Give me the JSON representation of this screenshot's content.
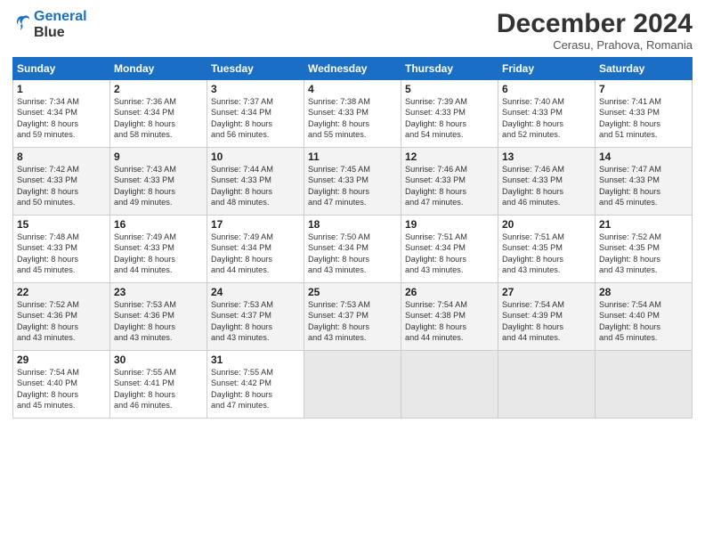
{
  "header": {
    "logo_line1": "General",
    "logo_line2": "Blue",
    "month_title": "December 2024",
    "subtitle": "Cerasu, Prahova, Romania"
  },
  "weekdays": [
    "Sunday",
    "Monday",
    "Tuesday",
    "Wednesday",
    "Thursday",
    "Friday",
    "Saturday"
  ],
  "weeks": [
    [
      {
        "day": "1",
        "sunrise": "7:34 AM",
        "sunset": "4:34 PM",
        "daylight": "8 hours and 59 minutes."
      },
      {
        "day": "2",
        "sunrise": "7:36 AM",
        "sunset": "4:34 PM",
        "daylight": "8 hours and 58 minutes."
      },
      {
        "day": "3",
        "sunrise": "7:37 AM",
        "sunset": "4:34 PM",
        "daylight": "8 hours and 56 minutes."
      },
      {
        "day": "4",
        "sunrise": "7:38 AM",
        "sunset": "4:33 PM",
        "daylight": "8 hours and 55 minutes."
      },
      {
        "day": "5",
        "sunrise": "7:39 AM",
        "sunset": "4:33 PM",
        "daylight": "8 hours and 54 minutes."
      },
      {
        "day": "6",
        "sunrise": "7:40 AM",
        "sunset": "4:33 PM",
        "daylight": "8 hours and 52 minutes."
      },
      {
        "day": "7",
        "sunrise": "7:41 AM",
        "sunset": "4:33 PM",
        "daylight": "8 hours and 51 minutes."
      }
    ],
    [
      {
        "day": "8",
        "sunrise": "7:42 AM",
        "sunset": "4:33 PM",
        "daylight": "8 hours and 50 minutes."
      },
      {
        "day": "9",
        "sunrise": "7:43 AM",
        "sunset": "4:33 PM",
        "daylight": "8 hours and 49 minutes."
      },
      {
        "day": "10",
        "sunrise": "7:44 AM",
        "sunset": "4:33 PM",
        "daylight": "8 hours and 48 minutes."
      },
      {
        "day": "11",
        "sunrise": "7:45 AM",
        "sunset": "4:33 PM",
        "daylight": "8 hours and 47 minutes."
      },
      {
        "day": "12",
        "sunrise": "7:46 AM",
        "sunset": "4:33 PM",
        "daylight": "8 hours and 47 minutes."
      },
      {
        "day": "13",
        "sunrise": "7:46 AM",
        "sunset": "4:33 PM",
        "daylight": "8 hours and 46 minutes."
      },
      {
        "day": "14",
        "sunrise": "7:47 AM",
        "sunset": "4:33 PM",
        "daylight": "8 hours and 45 minutes."
      }
    ],
    [
      {
        "day": "15",
        "sunrise": "7:48 AM",
        "sunset": "4:33 PM",
        "daylight": "8 hours and 45 minutes."
      },
      {
        "day": "16",
        "sunrise": "7:49 AM",
        "sunset": "4:33 PM",
        "daylight": "8 hours and 44 minutes."
      },
      {
        "day": "17",
        "sunrise": "7:49 AM",
        "sunset": "4:34 PM",
        "daylight": "8 hours and 44 minutes."
      },
      {
        "day": "18",
        "sunrise": "7:50 AM",
        "sunset": "4:34 PM",
        "daylight": "8 hours and 43 minutes."
      },
      {
        "day": "19",
        "sunrise": "7:51 AM",
        "sunset": "4:34 PM",
        "daylight": "8 hours and 43 minutes."
      },
      {
        "day": "20",
        "sunrise": "7:51 AM",
        "sunset": "4:35 PM",
        "daylight": "8 hours and 43 minutes."
      },
      {
        "day": "21",
        "sunrise": "7:52 AM",
        "sunset": "4:35 PM",
        "daylight": "8 hours and 43 minutes."
      }
    ],
    [
      {
        "day": "22",
        "sunrise": "7:52 AM",
        "sunset": "4:36 PM",
        "daylight": "8 hours and 43 minutes."
      },
      {
        "day": "23",
        "sunrise": "7:53 AM",
        "sunset": "4:36 PM",
        "daylight": "8 hours and 43 minutes."
      },
      {
        "day": "24",
        "sunrise": "7:53 AM",
        "sunset": "4:37 PM",
        "daylight": "8 hours and 43 minutes."
      },
      {
        "day": "25",
        "sunrise": "7:53 AM",
        "sunset": "4:37 PM",
        "daylight": "8 hours and 43 minutes."
      },
      {
        "day": "26",
        "sunrise": "7:54 AM",
        "sunset": "4:38 PM",
        "daylight": "8 hours and 44 minutes."
      },
      {
        "day": "27",
        "sunrise": "7:54 AM",
        "sunset": "4:39 PM",
        "daylight": "8 hours and 44 minutes."
      },
      {
        "day": "28",
        "sunrise": "7:54 AM",
        "sunset": "4:40 PM",
        "daylight": "8 hours and 45 minutes."
      }
    ],
    [
      {
        "day": "29",
        "sunrise": "7:54 AM",
        "sunset": "4:40 PM",
        "daylight": "8 hours and 45 minutes."
      },
      {
        "day": "30",
        "sunrise": "7:55 AM",
        "sunset": "4:41 PM",
        "daylight": "8 hours and 46 minutes."
      },
      {
        "day": "31",
        "sunrise": "7:55 AM",
        "sunset": "4:42 PM",
        "daylight": "8 hours and 47 minutes."
      },
      null,
      null,
      null,
      null
    ]
  ]
}
